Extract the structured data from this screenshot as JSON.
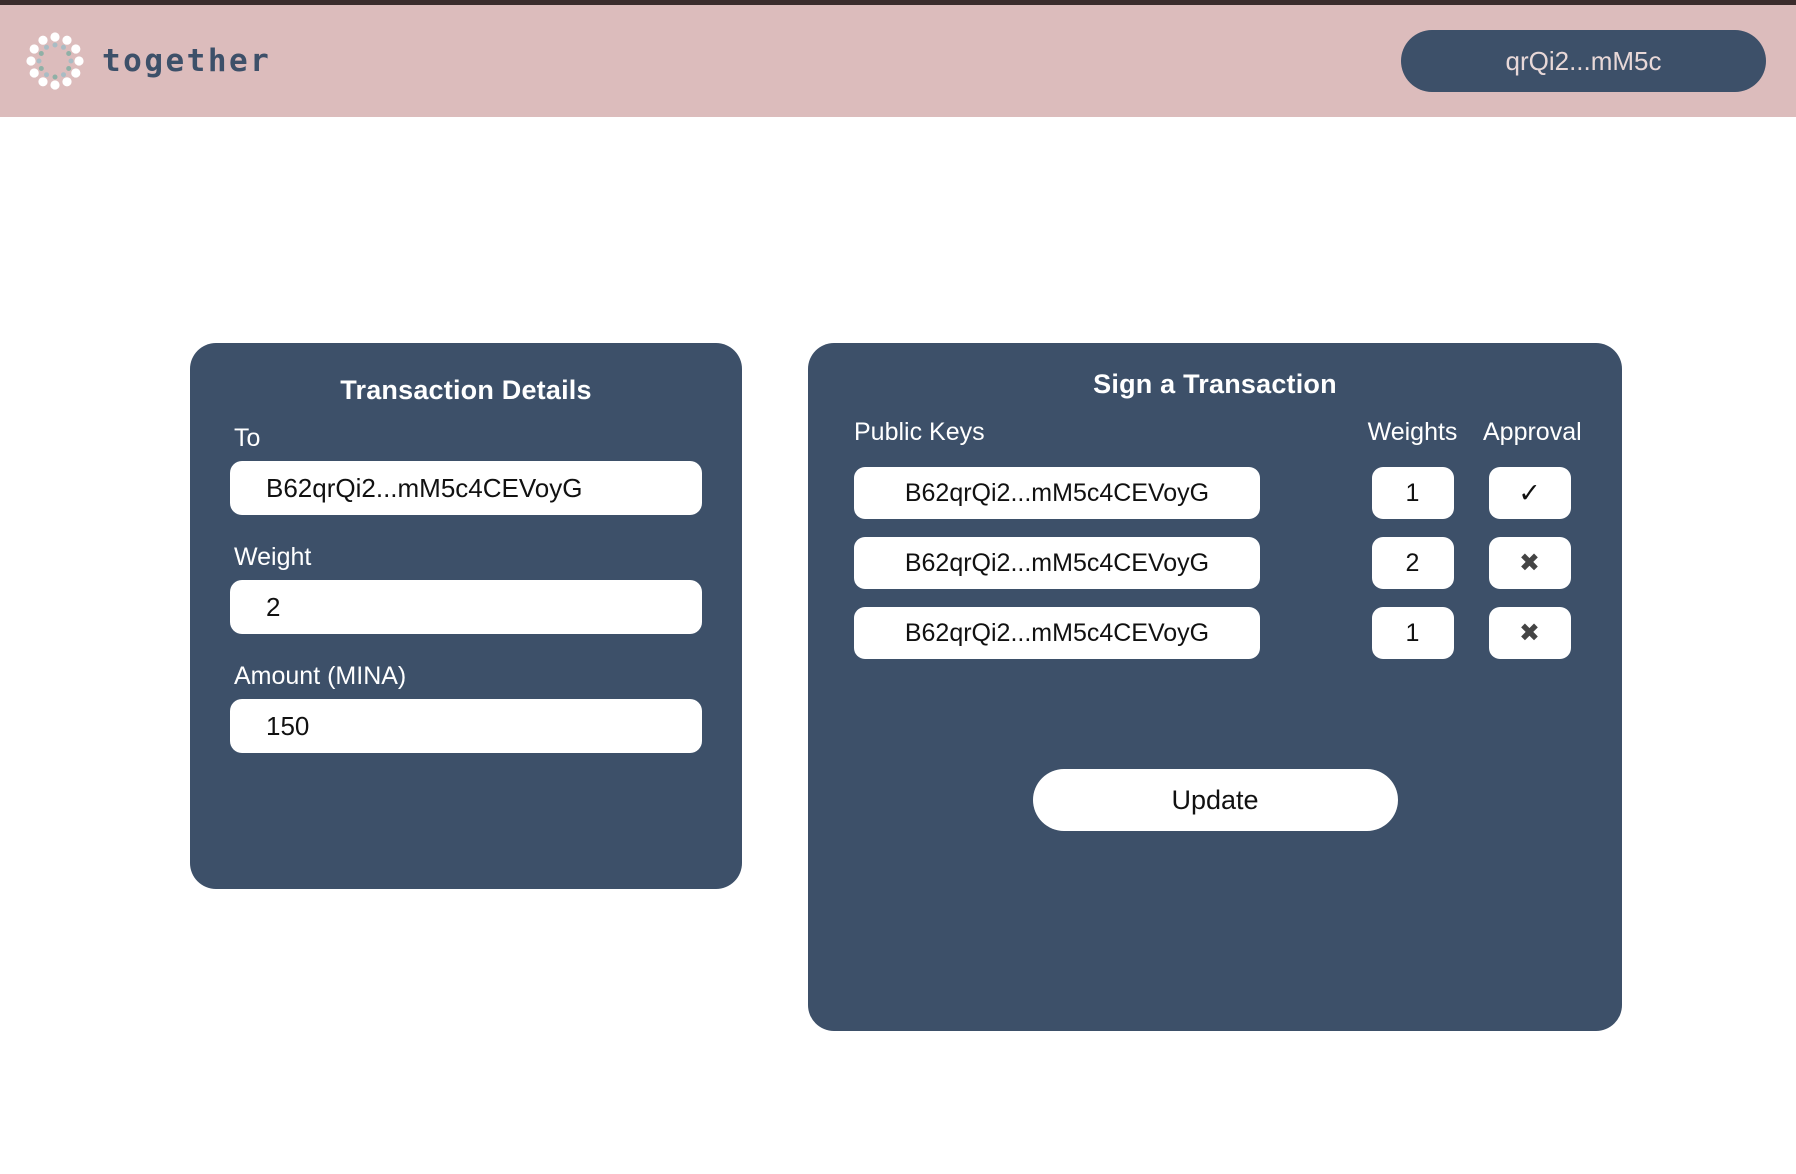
{
  "theme": {
    "header_bg": "#dcbcbc",
    "card_bg": "#3d5069",
    "page_bg": "#ffffff",
    "top_strip": "#3a2c2c",
    "input_bg": "#ffffff",
    "header_text": "#e8d8d8"
  },
  "header": {
    "brand_name": "together",
    "logo_icon": "dot-ring-icon",
    "account_label": "qrQi2...mM5c"
  },
  "transaction_details": {
    "title": "Transaction Details",
    "fields": [
      {
        "label": "To",
        "value": "B62qrQi2...mM5c4CEVoyG",
        "placeholder": "To"
      },
      {
        "label": "Weight",
        "value": "2",
        "placeholder": "Weight"
      },
      {
        "label": "Amount (MINA)",
        "value": "150",
        "placeholder": "Amount (MINA)"
      }
    ]
  },
  "sign_transaction": {
    "title": "Sign a Transaction",
    "columns": {
      "public_keys": "Public Keys",
      "weights": "Weights",
      "approval": "Approval"
    },
    "rows": [
      {
        "public_key": "B62qrQi2...mM5c4CEVoyG",
        "weight": "1",
        "approval": "✓",
        "approval_icon": "check-icon",
        "approved": true
      },
      {
        "public_key": "B62qrQi2...mM5c4CEVoyG",
        "weight": "2",
        "approval": "✖",
        "approval_icon": "cross-icon",
        "approved": false
      },
      {
        "public_key": "B62qrQi2...mM5c4CEVoyG",
        "weight": "1",
        "approval": "✖",
        "approval_icon": "cross-icon",
        "approved": false
      }
    ],
    "update_label": "Update"
  }
}
